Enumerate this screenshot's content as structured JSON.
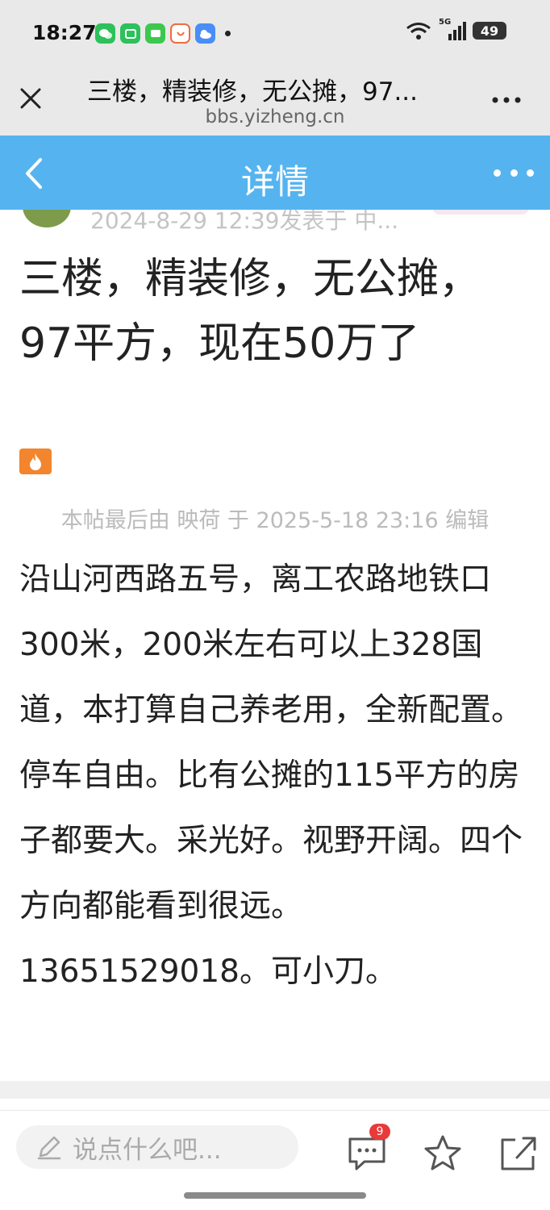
{
  "status_bar": {
    "time": "18:27",
    "network": "5G",
    "battery": "49",
    "notification_icons": [
      "wechat-icon",
      "mi-icon",
      "message-icon",
      "app-icon",
      "cloud-icon"
    ]
  },
  "browser": {
    "page_title": "三楼，精装修，无公摊，97...",
    "url": "bbs.yizheng.cn"
  },
  "header": {
    "title": "详情"
  },
  "post": {
    "meta_partial": "2024-8-29 12:39发表于 中...",
    "title": "三楼，精装修，无公摊，97平方，现在50万了",
    "edit_note": "本帖最后由 映荷 于 2025-5-18 23:16 编辑",
    "body": "沿山河西路五号，离工农路地铁口300米，200米左右可以上328国道，本打算自己养老用，全新配置。停车自由。比有公摊的115平方的房子都要大。采光好。视野开阔。四个方向都能看到很远。13651529018。可小刀。"
  },
  "bottom_bar": {
    "comment_placeholder": "说点什么吧...",
    "comment_count": "9"
  },
  "colors": {
    "header_bg": "#55b4f0",
    "hot_icon": "#f2852e",
    "badge": "#e83a3a"
  }
}
